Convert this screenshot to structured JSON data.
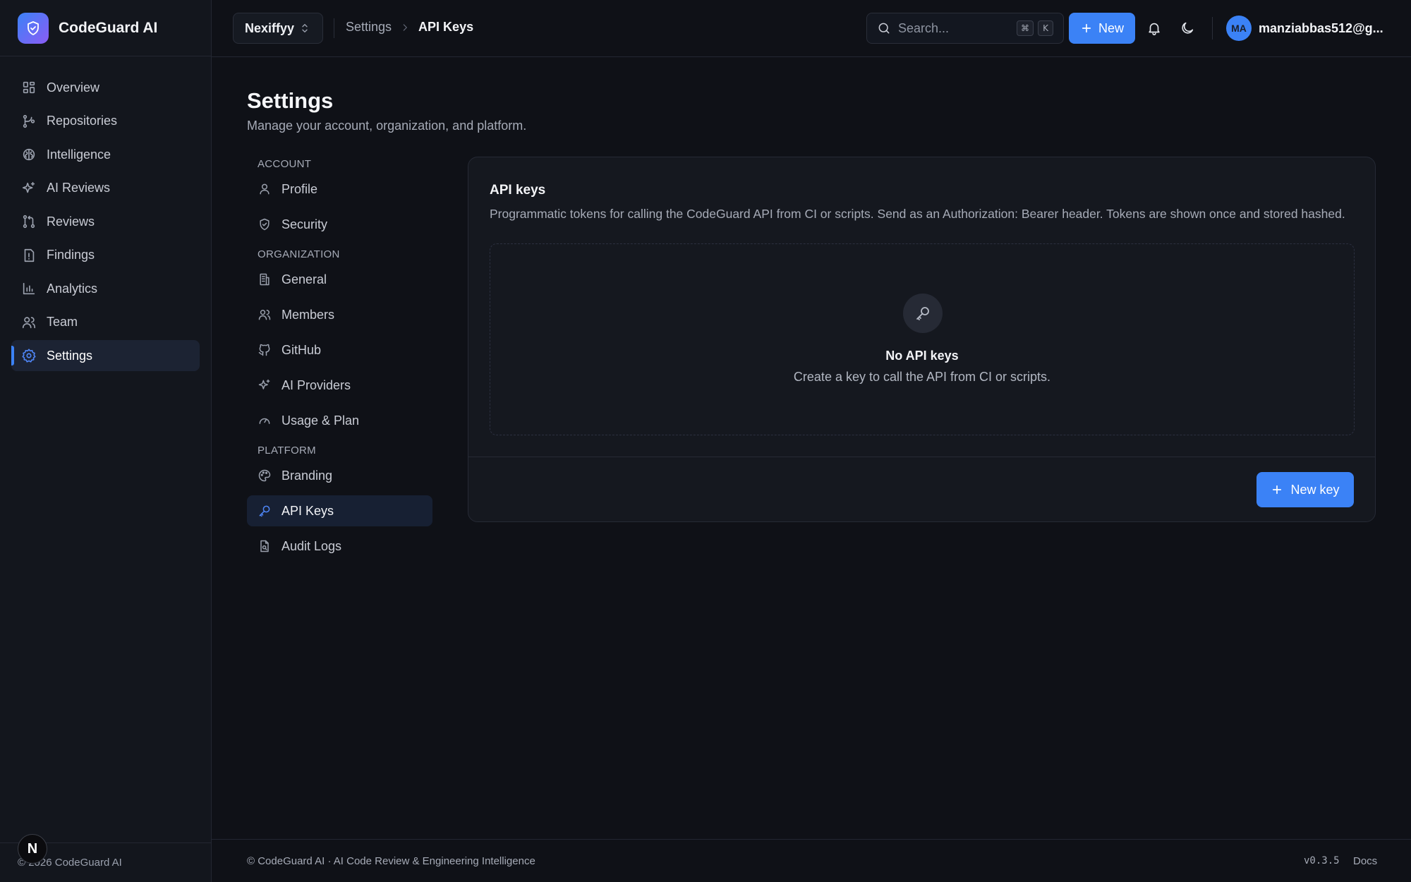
{
  "app": {
    "name": "CodeGuard AI"
  },
  "sidebar": {
    "items": [
      {
        "label": "Overview",
        "icon": "grid-icon"
      },
      {
        "label": "Repositories",
        "icon": "git-branch-icon"
      },
      {
        "label": "Intelligence",
        "icon": "brain-icon"
      },
      {
        "label": "AI Reviews",
        "icon": "sparkles-icon"
      },
      {
        "label": "Reviews",
        "icon": "git-pull-request-icon"
      },
      {
        "label": "Findings",
        "icon": "alert-file-icon"
      },
      {
        "label": "Analytics",
        "icon": "bar-chart-icon"
      },
      {
        "label": "Team",
        "icon": "users-icon"
      },
      {
        "label": "Settings",
        "icon": "gear-icon",
        "active": true
      }
    ],
    "footer": "© 2026 CodeGuard AI",
    "badge": "N"
  },
  "topbar": {
    "org": "Nexiffyy",
    "breadcrumb": {
      "parent": "Settings",
      "current": "API Keys"
    },
    "search": {
      "placeholder": "Search...",
      "shortcut": [
        "⌘",
        "K"
      ]
    },
    "new_label": "New",
    "user": {
      "initials": "MA",
      "name": "manziabbas512@g..."
    }
  },
  "page": {
    "title": "Settings",
    "subtitle": "Manage your account, organization, and platform."
  },
  "settings_nav": {
    "groups": [
      {
        "label": "ACCOUNT",
        "items": [
          {
            "label": "Profile",
            "icon": "user-icon"
          },
          {
            "label": "Security",
            "icon": "shield-icon"
          }
        ]
      },
      {
        "label": "ORGANIZATION",
        "items": [
          {
            "label": "General",
            "icon": "building-icon"
          },
          {
            "label": "Members",
            "icon": "users-icon"
          },
          {
            "label": "GitHub",
            "icon": "github-icon"
          },
          {
            "label": "AI Providers",
            "icon": "sparkles-icon"
          },
          {
            "label": "Usage & Plan",
            "icon": "gauge-icon"
          }
        ]
      },
      {
        "label": "PLATFORM",
        "items": [
          {
            "label": "Branding",
            "icon": "palette-icon"
          },
          {
            "label": "API Keys",
            "icon": "key-icon",
            "active": true
          },
          {
            "label": "Audit Logs",
            "icon": "file-search-icon"
          }
        ]
      }
    ]
  },
  "card": {
    "title": "API keys",
    "description": "Programmatic tokens for calling the CodeGuard API from CI or scripts. Send as an Authorization: Bearer header. Tokens are shown once and stored hashed.",
    "empty_title": "No API keys",
    "empty_subtitle": "Create a key to call the API from CI or scripts.",
    "new_key_label": "New key"
  },
  "footer": {
    "left": "© CodeGuard AI · AI Code Review & Engineering Intelligence",
    "version": "v0.3.5",
    "docs": "Docs"
  },
  "colors": {
    "accent": "#3b82f6",
    "background": "#0f1117",
    "surface": "#15181f"
  }
}
